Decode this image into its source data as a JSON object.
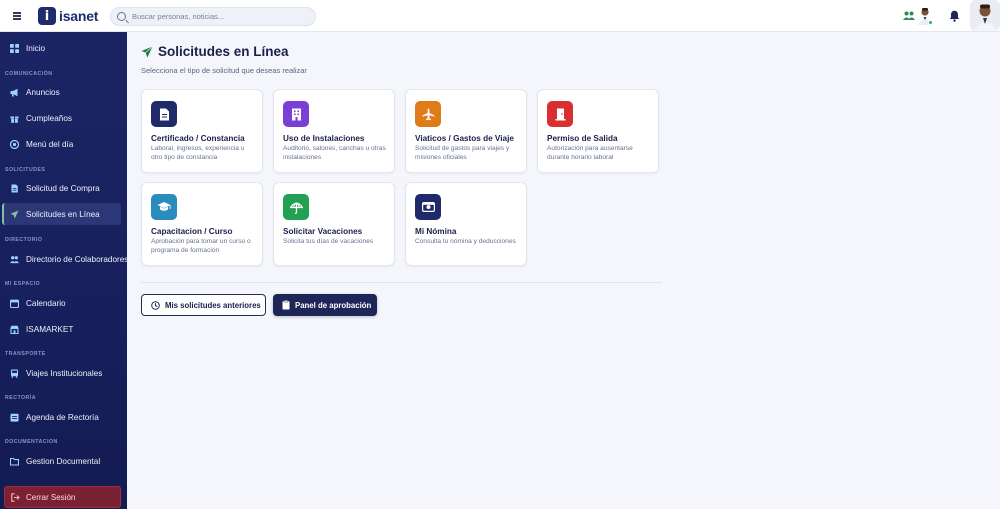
{
  "header": {
    "logo_text": "isanet",
    "logo_letter": "i",
    "search_placeholder": "Buscar personas, noticias..."
  },
  "sidebar": {
    "items": [
      {
        "label": "Inicio",
        "icon": "grid-icon"
      },
      {
        "section": "COMUNICACIÓN"
      },
      {
        "label": "Anuncios",
        "icon": "megaphone-icon"
      },
      {
        "label": "Cumpleaños",
        "icon": "gift-icon"
      },
      {
        "label": "Menú del día",
        "icon": "dish-icon"
      },
      {
        "section": "SOLICITUDES"
      },
      {
        "label": "Solicitud de Compra",
        "icon": "document-icon"
      },
      {
        "label": "Solicitudes en Línea",
        "icon": "send-icon",
        "active": true
      },
      {
        "section": "DIRECTORIO"
      },
      {
        "label": "Directorio de Colaboradores",
        "icon": "people-icon"
      },
      {
        "section": "MI ESPACIO"
      },
      {
        "label": "Calendario",
        "icon": "calendar-icon"
      },
      {
        "label": "ISAMARKET",
        "icon": "store-icon"
      },
      {
        "section": "TRANSPORTE"
      },
      {
        "label": "Viajes Institucionales",
        "icon": "bus-icon"
      },
      {
        "section": "RECTORÍA"
      },
      {
        "label": "Agenda de Rectoría",
        "icon": "agenda-icon"
      },
      {
        "section": "DOCUMENTACION"
      },
      {
        "label": "Gestion Documental",
        "icon": "folder-icon"
      }
    ],
    "logout_label": "Cerrar Sesión"
  },
  "main": {
    "title": "Solicitudes en Línea",
    "subtitle": "Selecciona el tipo de solicitud que deseas realizar",
    "cards": [
      {
        "title": "Certificado / Constancia",
        "desc": "Laboral, ingresos, experiencia u otro tipo de constancia",
        "color": "#1f2a6b",
        "icon": "document-icon"
      },
      {
        "title": "Uso de Instalaciones",
        "desc": "Auditorio, salones, canchas u otras instalaciones",
        "color": "#7a3fd6",
        "icon": "building-icon"
      },
      {
        "title": "Viaticos / Gastos de Viaje",
        "desc": "Solicitud de gastos para viajes y misiones oficiales",
        "color": "#e07b1a",
        "icon": "airplane-icon"
      },
      {
        "title": "Permiso de Salida",
        "desc": "Autorización para ausentarse durante horario laboral",
        "color": "#d9302f",
        "icon": "door-icon"
      },
      {
        "title": "Capacitacion / Curso",
        "desc": "Aprobación para tomar un curso o programa de formación",
        "color": "#2a8bbd",
        "icon": "graduation-cap-icon"
      },
      {
        "title": "Solicitar Vacaciones",
        "desc": "Solicita tus días de vacaciones",
        "color": "#23a152",
        "icon": "umbrella-icon"
      },
      {
        "title": "Mi Nómina",
        "desc": "Consulta tu nómina y deducciones",
        "color": "#1f2a6b",
        "icon": "money-icon"
      }
    ],
    "buttons": {
      "history_label": "Mis solicitudes anteriores",
      "approval_label": "Panel de aprobación"
    }
  }
}
